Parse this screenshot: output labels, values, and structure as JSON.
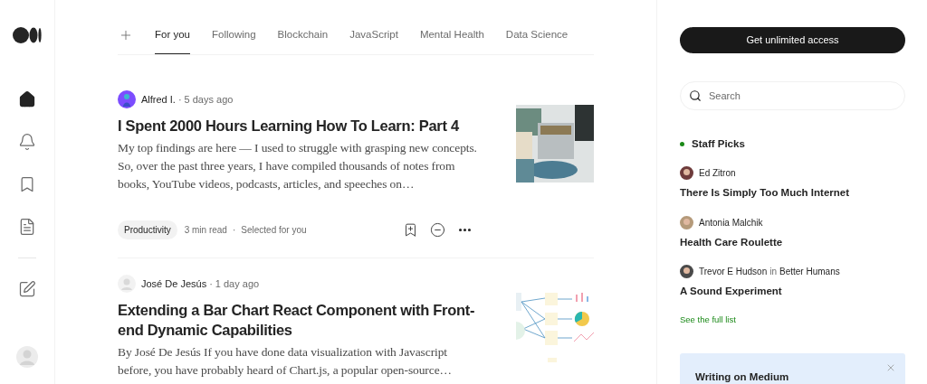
{
  "sidebar": {
    "nav": [
      {
        "kind": "home",
        "selected": true
      },
      {
        "kind": "notifications",
        "selected": false
      },
      {
        "kind": "library",
        "selected": false
      },
      {
        "kind": "stories",
        "selected": false
      },
      {
        "kind": "write",
        "selected": false
      }
    ]
  },
  "tabs": [
    {
      "label": "For you",
      "selected": true
    },
    {
      "label": "Following",
      "selected": false
    },
    {
      "label": "Blockchain",
      "selected": false
    },
    {
      "label": "JavaScript",
      "selected": false
    },
    {
      "label": "Mental Health",
      "selected": false
    },
    {
      "label": "Data Science",
      "selected": false
    }
  ],
  "articles": [
    {
      "author": "Alfred I.",
      "time": "5 days ago",
      "title": "I Spent 2000 Hours Learning How To Learn: Part 4",
      "excerpt": "My top findings are here — I used to struggle with grasping new concepts. So, over the past three years, I have compiled thousands of notes from books, YouTube videos, podcasts, articles, and speeches on…",
      "tag": "Productivity",
      "read_time": "3 min read",
      "note_separator": "·",
      "note": "Selected for you",
      "separator": "·"
    },
    {
      "author": "José De Jesús",
      "time": "1 day ago",
      "title": "Extending a Bar Chart React Component with Front-end Dynamic Capabilities",
      "excerpt": "By José De Jesús If you have done data visualization with Javascript before, you have probably heard of Chart.js, a popular open-source…",
      "separator": "·"
    }
  ],
  "aside": {
    "cta": "Get unlimited access",
    "search": {
      "placeholder": "Search"
    },
    "staff_picks": {
      "title": "Staff Picks",
      "items": [
        {
          "author": "Ed Zitron",
          "title": "There Is Simply Too Much Internet"
        },
        {
          "author": "Antonia Malchik",
          "title": "Health Care Roulette"
        },
        {
          "author": "Trevor E Hudson",
          "in": "in",
          "publication": "Better Humans",
          "title": "A Sound Experiment"
        }
      ],
      "link": "See the full list"
    },
    "card": {
      "title": "Writing on Medium"
    }
  }
}
